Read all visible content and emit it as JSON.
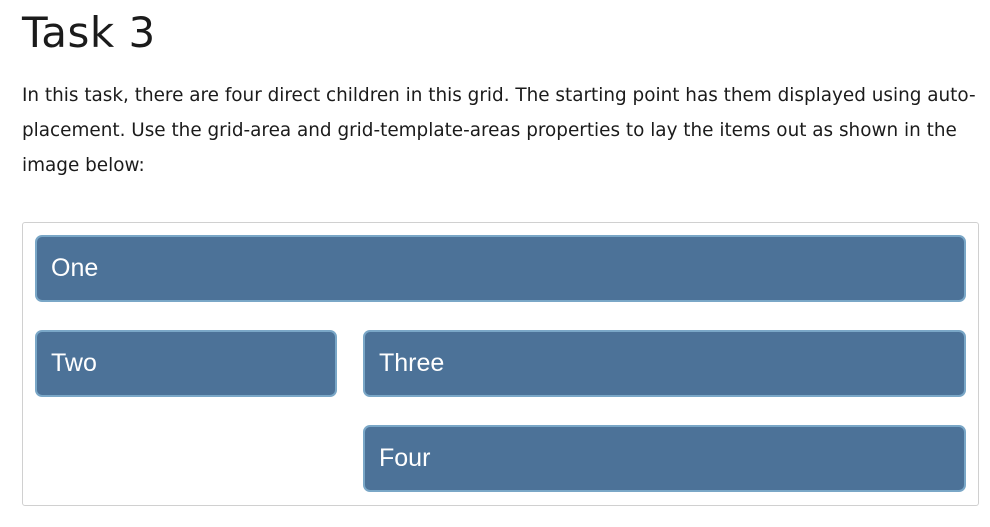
{
  "page": {
    "title": "Task 3",
    "intro": "In this task, there are four direct children in this grid. The starting point has them displayed using auto-placement. Use the grid-area and grid-template-areas properties to lay the items out as shown in the image below:"
  },
  "grid": {
    "items": [
      {
        "label": "One"
      },
      {
        "label": "Two"
      },
      {
        "label": "Three"
      },
      {
        "label": "Four"
      }
    ],
    "colors": {
      "item_background": "#4c7298",
      "item_border": "#7aa7c7",
      "item_text": "#ffffff",
      "frame_border": "#d0d0d0"
    }
  }
}
